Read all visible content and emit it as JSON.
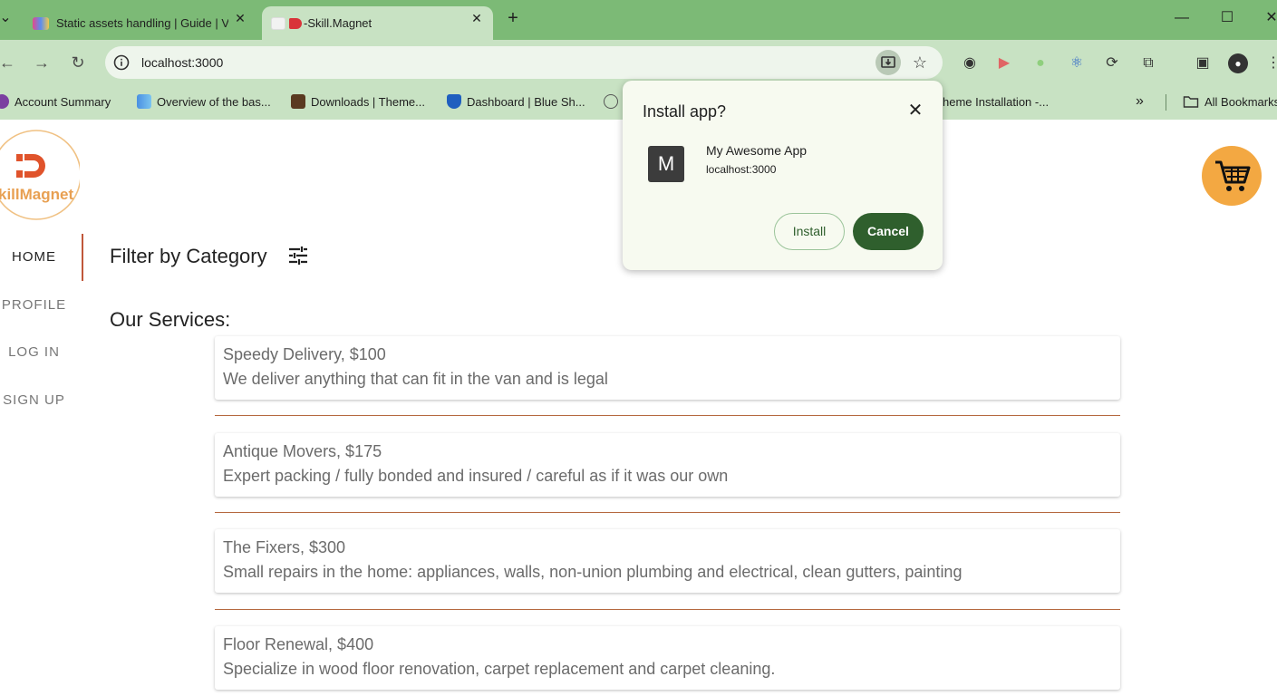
{
  "browser": {
    "tabs": [
      {
        "title": "Static assets handling | Guide | V",
        "active": false
      },
      {
        "title": "-Skill.Magnet",
        "active": true
      }
    ],
    "new_tab_label": "+",
    "address": "localhost:3000",
    "bookmarks": [
      {
        "label": "Account Summary"
      },
      {
        "label": "Overview of the bas..."
      },
      {
        "label": "Downloads | Theme..."
      },
      {
        "label": "Dashboard | Blue Sh..."
      },
      {
        "label": "heme Installation -..."
      }
    ],
    "bookmarks_overflow": "»",
    "all_bookmarks_label": "All Bookmarks"
  },
  "brand": {
    "logo_text": "killMagnet",
    "accent": "#e0532b",
    "ring": "#f0c183"
  },
  "nav": {
    "items": [
      {
        "label": "HOME",
        "active": true
      },
      {
        "label": "PROFILE"
      },
      {
        "label": "LOG IN"
      },
      {
        "label": "SIGN UP"
      }
    ]
  },
  "main": {
    "filter_title": "Filter by Category",
    "services_title": "Our Services:",
    "services": [
      {
        "title": "Speedy Delivery, $100",
        "description": "We deliver anything that can fit in the van and is legal"
      },
      {
        "title": "Antique Movers, $175",
        "description": "Expert packing / fully bonded and insured / careful as if it was our own"
      },
      {
        "title": "The Fixers, $300",
        "description": "Small repairs in the home: appliances, walls, non-union plumbing and electrical, clean gutters, painting"
      },
      {
        "title": "Floor Renewal, $400",
        "description": "Specialize in wood floor renovation, carpet replacement and carpet cleaning."
      }
    ]
  },
  "install_dialog": {
    "title": "Install app?",
    "app_icon_letter": "M",
    "app_name": "My Awesome App",
    "app_url": "localhost:3000",
    "install_label": "Install",
    "cancel_label": "Cancel"
  },
  "colors": {
    "tab_strip": "#7cba76",
    "toolbar": "#c8e2c3",
    "cart": "#f3a842",
    "cancel_button": "#2f5f2d"
  }
}
